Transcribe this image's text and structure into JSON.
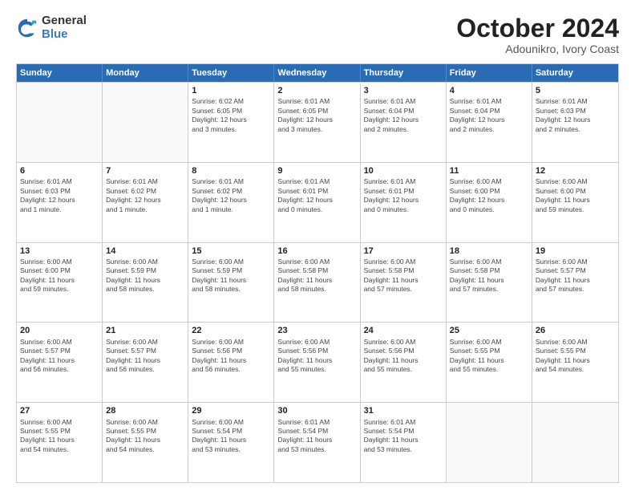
{
  "logo": {
    "general": "General",
    "blue": "Blue"
  },
  "title": {
    "month": "October 2024",
    "location": "Adounikro, Ivory Coast"
  },
  "calendar": {
    "headers": [
      "Sunday",
      "Monday",
      "Tuesday",
      "Wednesday",
      "Thursday",
      "Friday",
      "Saturday"
    ],
    "rows": [
      [
        {
          "day": "",
          "info": ""
        },
        {
          "day": "",
          "info": ""
        },
        {
          "day": "1",
          "info": "Sunrise: 6:02 AM\nSunset: 6:05 PM\nDaylight: 12 hours\nand 3 minutes."
        },
        {
          "day": "2",
          "info": "Sunrise: 6:01 AM\nSunset: 6:05 PM\nDaylight: 12 hours\nand 3 minutes."
        },
        {
          "day": "3",
          "info": "Sunrise: 6:01 AM\nSunset: 6:04 PM\nDaylight: 12 hours\nand 2 minutes."
        },
        {
          "day": "4",
          "info": "Sunrise: 6:01 AM\nSunset: 6:04 PM\nDaylight: 12 hours\nand 2 minutes."
        },
        {
          "day": "5",
          "info": "Sunrise: 6:01 AM\nSunset: 6:03 PM\nDaylight: 12 hours\nand 2 minutes."
        }
      ],
      [
        {
          "day": "6",
          "info": "Sunrise: 6:01 AM\nSunset: 6:03 PM\nDaylight: 12 hours\nand 1 minute."
        },
        {
          "day": "7",
          "info": "Sunrise: 6:01 AM\nSunset: 6:02 PM\nDaylight: 12 hours\nand 1 minute."
        },
        {
          "day": "8",
          "info": "Sunrise: 6:01 AM\nSunset: 6:02 PM\nDaylight: 12 hours\nand 1 minute."
        },
        {
          "day": "9",
          "info": "Sunrise: 6:01 AM\nSunset: 6:01 PM\nDaylight: 12 hours\nand 0 minutes."
        },
        {
          "day": "10",
          "info": "Sunrise: 6:01 AM\nSunset: 6:01 PM\nDaylight: 12 hours\nand 0 minutes."
        },
        {
          "day": "11",
          "info": "Sunrise: 6:00 AM\nSunset: 6:00 PM\nDaylight: 12 hours\nand 0 minutes."
        },
        {
          "day": "12",
          "info": "Sunrise: 6:00 AM\nSunset: 6:00 PM\nDaylight: 11 hours\nand 59 minutes."
        }
      ],
      [
        {
          "day": "13",
          "info": "Sunrise: 6:00 AM\nSunset: 6:00 PM\nDaylight: 11 hours\nand 59 minutes."
        },
        {
          "day": "14",
          "info": "Sunrise: 6:00 AM\nSunset: 5:59 PM\nDaylight: 11 hours\nand 58 minutes."
        },
        {
          "day": "15",
          "info": "Sunrise: 6:00 AM\nSunset: 5:59 PM\nDaylight: 11 hours\nand 58 minutes."
        },
        {
          "day": "16",
          "info": "Sunrise: 6:00 AM\nSunset: 5:58 PM\nDaylight: 11 hours\nand 58 minutes."
        },
        {
          "day": "17",
          "info": "Sunrise: 6:00 AM\nSunset: 5:58 PM\nDaylight: 11 hours\nand 57 minutes."
        },
        {
          "day": "18",
          "info": "Sunrise: 6:00 AM\nSunset: 5:58 PM\nDaylight: 11 hours\nand 57 minutes."
        },
        {
          "day": "19",
          "info": "Sunrise: 6:00 AM\nSunset: 5:57 PM\nDaylight: 11 hours\nand 57 minutes."
        }
      ],
      [
        {
          "day": "20",
          "info": "Sunrise: 6:00 AM\nSunset: 5:57 PM\nDaylight: 11 hours\nand 56 minutes."
        },
        {
          "day": "21",
          "info": "Sunrise: 6:00 AM\nSunset: 5:57 PM\nDaylight: 11 hours\nand 56 minutes."
        },
        {
          "day": "22",
          "info": "Sunrise: 6:00 AM\nSunset: 5:56 PM\nDaylight: 11 hours\nand 56 minutes."
        },
        {
          "day": "23",
          "info": "Sunrise: 6:00 AM\nSunset: 5:56 PM\nDaylight: 11 hours\nand 55 minutes."
        },
        {
          "day": "24",
          "info": "Sunrise: 6:00 AM\nSunset: 5:56 PM\nDaylight: 11 hours\nand 55 minutes."
        },
        {
          "day": "25",
          "info": "Sunrise: 6:00 AM\nSunset: 5:55 PM\nDaylight: 11 hours\nand 55 minutes."
        },
        {
          "day": "26",
          "info": "Sunrise: 6:00 AM\nSunset: 5:55 PM\nDaylight: 11 hours\nand 54 minutes."
        }
      ],
      [
        {
          "day": "27",
          "info": "Sunrise: 6:00 AM\nSunset: 5:55 PM\nDaylight: 11 hours\nand 54 minutes."
        },
        {
          "day": "28",
          "info": "Sunrise: 6:00 AM\nSunset: 5:55 PM\nDaylight: 11 hours\nand 54 minutes."
        },
        {
          "day": "29",
          "info": "Sunrise: 6:00 AM\nSunset: 5:54 PM\nDaylight: 11 hours\nand 53 minutes."
        },
        {
          "day": "30",
          "info": "Sunrise: 6:01 AM\nSunset: 5:54 PM\nDaylight: 11 hours\nand 53 minutes."
        },
        {
          "day": "31",
          "info": "Sunrise: 6:01 AM\nSunset: 5:54 PM\nDaylight: 11 hours\nand 53 minutes."
        },
        {
          "day": "",
          "info": ""
        },
        {
          "day": "",
          "info": ""
        }
      ]
    ]
  }
}
